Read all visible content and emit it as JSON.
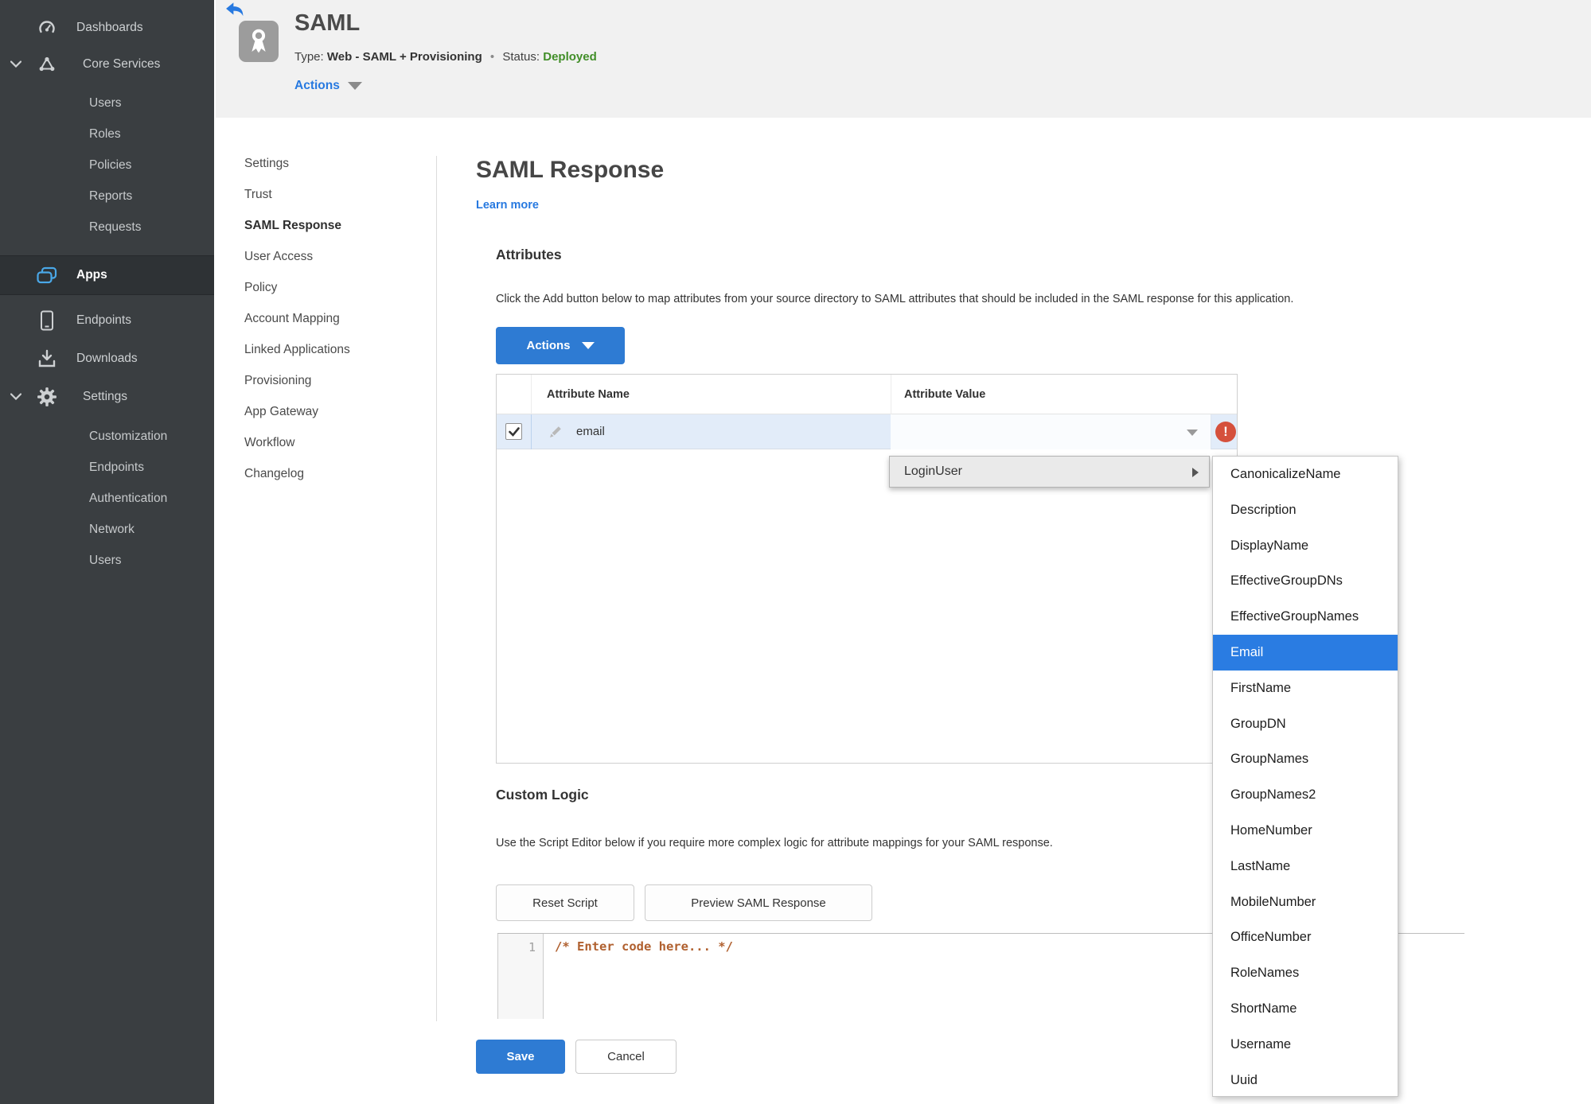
{
  "colors": {
    "accent_blue": "#2e7bd3",
    "link_blue": "#2779e0",
    "status_green": "#418e28",
    "error_red": "#d5503c",
    "sidebar_bg": "#3a3e41",
    "sidebar_active_bg": "#2e3235",
    "apps_icon_blue": "#4aa8e8",
    "row_highlight": "#e2ecf9",
    "menu_selected_blue": "#2a7ce2",
    "header_bg": "#f1f1f1",
    "code_text": "#b0602f"
  },
  "icons": [
    "back-arrow-icon",
    "app-ribbon-icon",
    "gauge-icon",
    "core-services-icon",
    "apps-icon",
    "endpoints-icon",
    "downloads-icon",
    "gear-icon",
    "chevron-down-icon",
    "dropdown-caret-icon",
    "pencil-icon",
    "checkbox-check-icon",
    "error-icon",
    "submenu-arrow-icon"
  ],
  "sidebar": {
    "items": [
      {
        "label": "Dashboards"
      },
      {
        "label": "Core Services",
        "expanded": true
      },
      {
        "label": "Users"
      },
      {
        "label": "Roles"
      },
      {
        "label": "Policies"
      },
      {
        "label": "Reports"
      },
      {
        "label": "Requests"
      },
      {
        "label": "Apps",
        "active": true
      },
      {
        "label": "Endpoints"
      },
      {
        "label": "Downloads"
      },
      {
        "label": "Settings",
        "expanded": true
      },
      {
        "label": "Customization"
      },
      {
        "label": "Endpoints"
      },
      {
        "label": "Authentication"
      },
      {
        "label": "Network"
      },
      {
        "label": "Users"
      }
    ]
  },
  "header": {
    "app_name": "SAML",
    "type_label": "Type:",
    "type_value": "Web - SAML + Provisioning",
    "separator": "•",
    "status_label": "Status:",
    "status_value": "Deployed",
    "actions_label": "Actions"
  },
  "subnav": {
    "items": [
      {
        "label": "Settings"
      },
      {
        "label": "Trust"
      },
      {
        "label": "SAML Response",
        "active": true
      },
      {
        "label": "User Access"
      },
      {
        "label": "Policy"
      },
      {
        "label": "Account Mapping"
      },
      {
        "label": "Linked Applications"
      },
      {
        "label": "Provisioning"
      },
      {
        "label": "App Gateway"
      },
      {
        "label": "Workflow"
      },
      {
        "label": "Changelog"
      }
    ]
  },
  "main": {
    "title": "SAML Response",
    "learn_more_label": "Learn more",
    "attributes_heading": "Attributes",
    "attributes_description": "Click the Add button below to map attributes from your source directory to SAML attributes that should be included in the SAML response for this application.",
    "actions_button_label": "Actions",
    "table": {
      "columns": [
        "Attribute Name",
        "Attribute Value"
      ],
      "rows": [
        {
          "name": "email",
          "value": "",
          "checked": true,
          "has_error": true
        }
      ]
    },
    "error_icon_glyph": "!",
    "custom_logic_heading": "Custom Logic",
    "custom_logic_description": "Use the Script Editor below if you require more complex logic for attribute mappings for your SAML response.",
    "reset_button_label": "Reset Script",
    "preview_button_label": "Preview SAML Response",
    "editor": {
      "line_number": "1",
      "code": "/* Enter code here... */"
    },
    "save_button_label": "Save",
    "cancel_button_label": "Cancel"
  },
  "dropdown": {
    "parent_label": "LoginUser",
    "selected_item": "Email",
    "items": [
      {
        "label": "CanonicalizeName"
      },
      {
        "label": "Description"
      },
      {
        "label": "DisplayName"
      },
      {
        "label": "EffectiveGroupDNs"
      },
      {
        "label": "EffectiveGroupNames"
      },
      {
        "label": "Email",
        "selected": true
      },
      {
        "label": "FirstName"
      },
      {
        "label": "GroupDN"
      },
      {
        "label": "GroupNames"
      },
      {
        "label": "GroupNames2"
      },
      {
        "label": "HomeNumber"
      },
      {
        "label": "LastName"
      },
      {
        "label": "MobileNumber"
      },
      {
        "label": "OfficeNumber"
      },
      {
        "label": "RoleNames"
      },
      {
        "label": "ShortName"
      },
      {
        "label": "Username"
      },
      {
        "label": "Uuid"
      }
    ]
  }
}
